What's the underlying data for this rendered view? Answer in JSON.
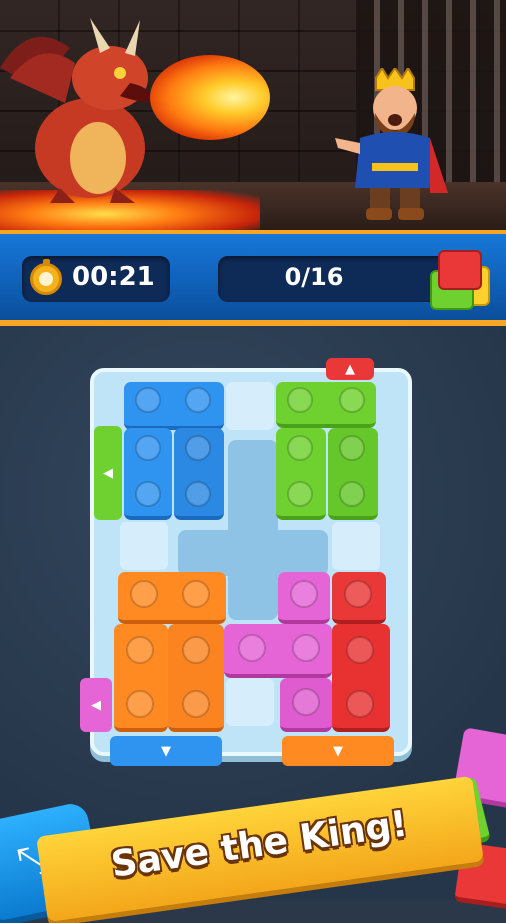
{
  "hud": {
    "timer": "00:21",
    "progress": "0/16"
  },
  "banner": {
    "text": "Save the King!"
  },
  "colors": {
    "blue": "#2f93f0",
    "green": "#6fd12f",
    "orange": "#ff8a22",
    "pink": "#e564d6",
    "red": "#ea3838",
    "tray": "#bfe3f7",
    "hud": "#1877d8",
    "accent": "#f6a623"
  },
  "icons": {
    "timer": "stopwatch-icon",
    "progress": "block-stack-icon",
    "corner": "diagonal-arrow-icon"
  }
}
